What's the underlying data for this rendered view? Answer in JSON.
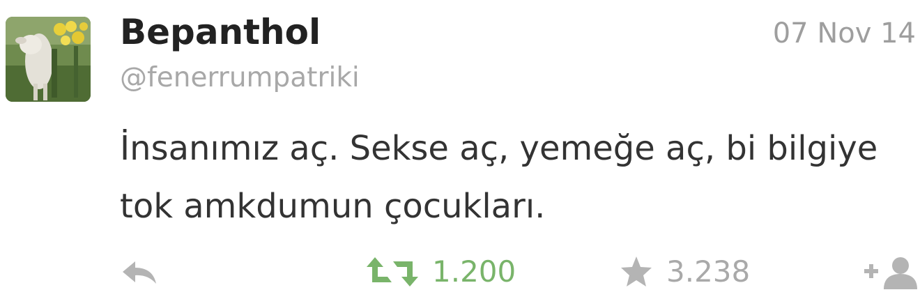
{
  "tweet": {
    "display_name": "Bepanthol",
    "handle": "@fenerrumpatriki",
    "timestamp": "07 Nov 14",
    "text": "İnsanımız aç. Sekse aç, yemeğe aç, bi bilgiye tok amkdumun çocukları.",
    "avatar_icon": "lamb-with-yellow-flowers-avatar"
  },
  "actions": {
    "reply_icon": "reply-arrow-icon",
    "retweet_icon": "retweet-icon",
    "retweet_count": "1.200",
    "favorite_icon": "star-icon",
    "favorite_count": "3.238",
    "follow_icon": "add-user-icon"
  },
  "colors": {
    "text": "#333333",
    "handle_gray": "#a8a8a8",
    "retweet_green": "#79b46a",
    "icon_gray": "#b4b4b4"
  }
}
